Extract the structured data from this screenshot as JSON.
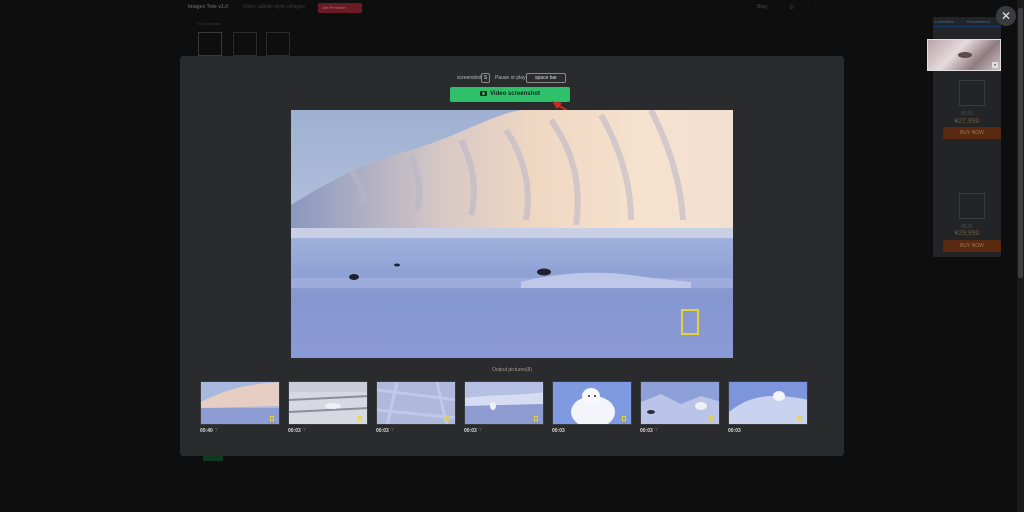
{
  "background": {
    "brand": "Images Tote v1.0",
    "tagline": "Video subtitle style collagen",
    "badge": "Get Premium",
    "blog_label": "Blog",
    "tool_label": "Tool selection"
  },
  "ad": {
    "tabs": [
      "Lubricants",
      "Recommend"
    ],
    "items": [
      {
        "brand": "MUJI",
        "price": "¥27,990",
        "buy": "BUY NOW"
      },
      {
        "brand": "MUJI",
        "price": "¥29,990",
        "buy": "BUY NOW"
      }
    ]
  },
  "modal": {
    "controls": {
      "screenshot_label": "screenshot",
      "screenshot_key": "S",
      "pause_label": "Pause or play",
      "pause_key": "space bar"
    },
    "screenshot_button": "Video screenshot",
    "output_label": "Output pictures(8)",
    "thumbnails": [
      {
        "time": "00:40",
        "q": "?"
      },
      {
        "time": "00:03",
        "q": "?"
      },
      {
        "time": "00:03",
        "q": "?"
      },
      {
        "time": "00:03",
        "q": "?"
      },
      {
        "time": "00:03",
        "q": ""
      },
      {
        "time": "00:03",
        "q": "?"
      },
      {
        "time": "00:03",
        "q": ""
      }
    ]
  },
  "colors": {
    "accent_green": "#2ec06a",
    "modal_bg": "#2a2b2d",
    "overlay": "#0e0e0f",
    "arrow_red": "#d42a1e",
    "ng_yellow": "#e6d23a"
  }
}
